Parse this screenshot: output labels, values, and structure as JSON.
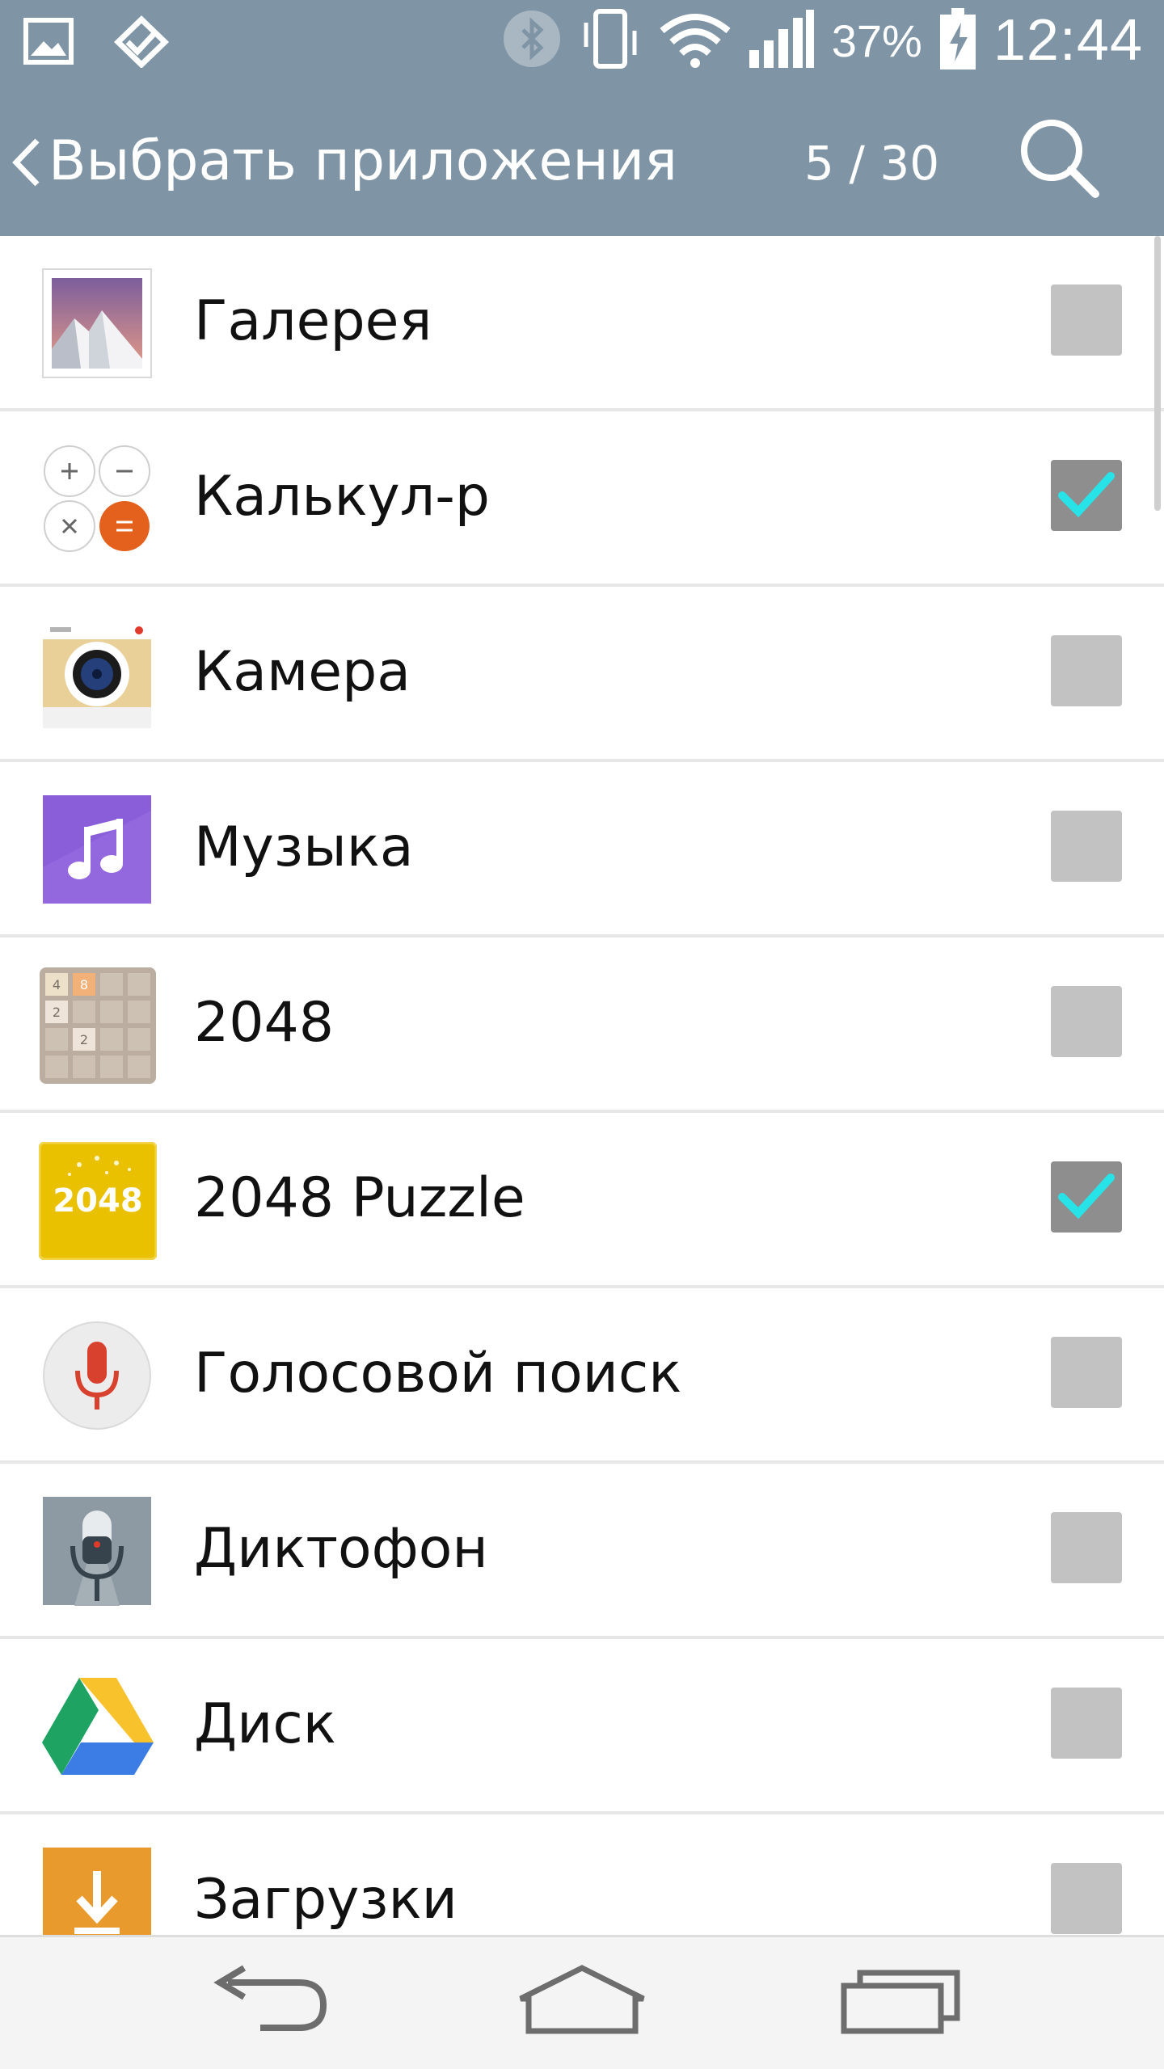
{
  "status_bar": {
    "left_icons": [
      "image-icon",
      "task-check-icon"
    ],
    "right_icons": [
      "bluetooth-icon",
      "vibrate-icon",
      "wifi-icon",
      "signal-icon"
    ],
    "battery_percent": "37%",
    "time": "12:44",
    "battery_level": 0.37
  },
  "app_bar": {
    "title": "Выбрать приложения",
    "count": "5 / 30",
    "back_icon": "chevron-left-icon",
    "search_icon": "search-icon"
  },
  "apps": [
    {
      "label": "Галерея",
      "icon": "gallery-icon",
      "checked": false
    },
    {
      "label": "Калькул-р",
      "icon": "calculator-icon",
      "checked": true
    },
    {
      "label": "Камера",
      "icon": "camera-icon",
      "checked": false
    },
    {
      "label": "Музыка",
      "icon": "music-icon",
      "checked": false
    },
    {
      "label": "2048",
      "icon": "game-2048-icon",
      "checked": false
    },
    {
      "label": "2048 Puzzle",
      "icon": "puzzle-2048-icon",
      "checked": true
    },
    {
      "label": "Голосовой поиск",
      "icon": "voice-search-icon",
      "checked": false
    },
    {
      "label": "Диктофон",
      "icon": "voice-recorder-icon",
      "checked": false
    },
    {
      "label": "Диск",
      "icon": "drive-icon",
      "checked": false
    },
    {
      "label": "Загрузки",
      "icon": "downloads-icon",
      "checked": false
    }
  ],
  "icon_texts": {
    "tile_4": "4",
    "tile_8": "8",
    "tile_2a": "2",
    "tile_2b": "2",
    "puzzle_logo": "2048"
  },
  "nav_bar": {
    "buttons": [
      "back-arrow-icon",
      "home-icon",
      "recent-apps-icon"
    ]
  },
  "colors": {
    "header": "#7f95a5",
    "checkbox": "#c2c2c2",
    "checkbox_checked": "#8e8e8e",
    "checkmark": "#27e3e8"
  }
}
